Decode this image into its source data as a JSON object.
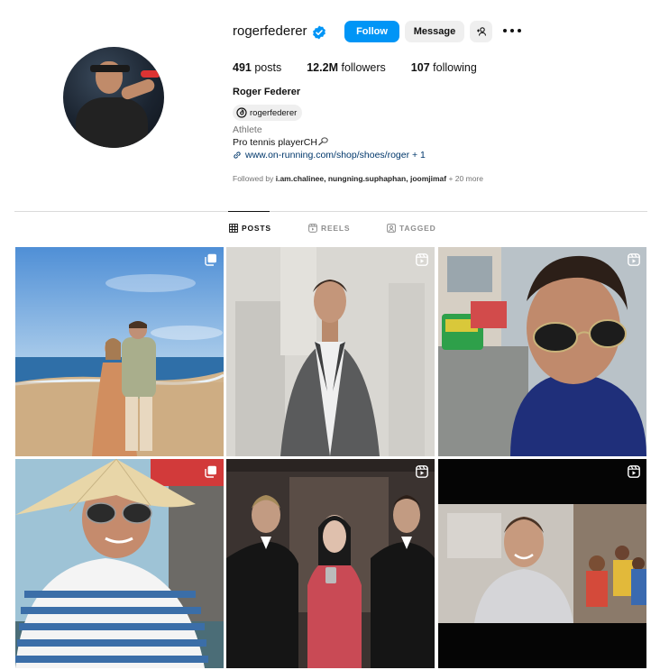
{
  "profile": {
    "username": "rogerfederer",
    "follow_label": "Follow",
    "message_label": "Message",
    "posts_count": "491",
    "posts_label": "posts",
    "followers_count": "12.2M",
    "followers_label": "followers",
    "following_count": "107",
    "following_label": "following",
    "full_name": "Roger Federer",
    "threads_handle": "rogerfederer",
    "category": "Athlete",
    "bio": "Pro tennis playerCH",
    "link": "www.on-running.com/shop/shoes/roger + 1",
    "followed_by_prefix": "Followed by ",
    "followed_by_users": "i.am.chalinee, nungning.suphaphan, joomjimaf",
    "followed_by_suffix": " + 20 more"
  },
  "tabs": [
    {
      "label": "POSTS",
      "active": true,
      "icon": "grid-icon"
    },
    {
      "label": "REELS",
      "active": false,
      "icon": "reels-icon"
    },
    {
      "label": "TAGGED",
      "active": false,
      "icon": "tagged-icon"
    }
  ],
  "posts": [
    {
      "badge": "carousel-icon"
    },
    {
      "badge": "reel-icon"
    },
    {
      "badge": "reel-icon"
    },
    {
      "badge": "carousel-icon"
    },
    {
      "badge": "reel-icon"
    },
    {
      "badge": "reel-icon"
    }
  ],
  "colors": {
    "accent": "#0095f6",
    "secondary_button": "#efefef",
    "muted_text": "#737373",
    "link": "#00376b",
    "divider": "#dbdbdb"
  }
}
